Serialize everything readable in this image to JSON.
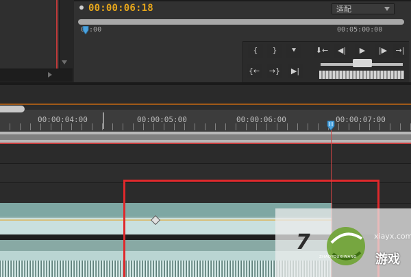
{
  "monitor": {
    "timecode": "00:00:06:18",
    "fit_label": "适配",
    "ruler_start": "00:00",
    "ruler_mid": "00:05:00:00"
  },
  "controls": {
    "mark_in": "{",
    "mark_out": "}",
    "add_marker": "⯆",
    "go_to_in": "{←",
    "go_to_out": "→}",
    "play_in_to_out": "▶|",
    "step_back_marker": "⬇←",
    "step_back": "◀|",
    "play": "▶",
    "step_forward": "|▶",
    "step_forward_marker": "→|"
  },
  "timeline": {
    "ticks": [
      "00:00:04:00",
      "00:00:05:00",
      "00:00:06:00",
      "00:00:07:00"
    ]
  },
  "watermark": {
    "digit": "7",
    "site": "xiayx.com",
    "sub": "ZHAOYOUXIWANG",
    "youxi": "游戏"
  },
  "colors": {
    "timecode": "#e6a61b",
    "selection": "#e0282b",
    "playhead": "#d14444",
    "clip_audio": "#99b7b2"
  }
}
